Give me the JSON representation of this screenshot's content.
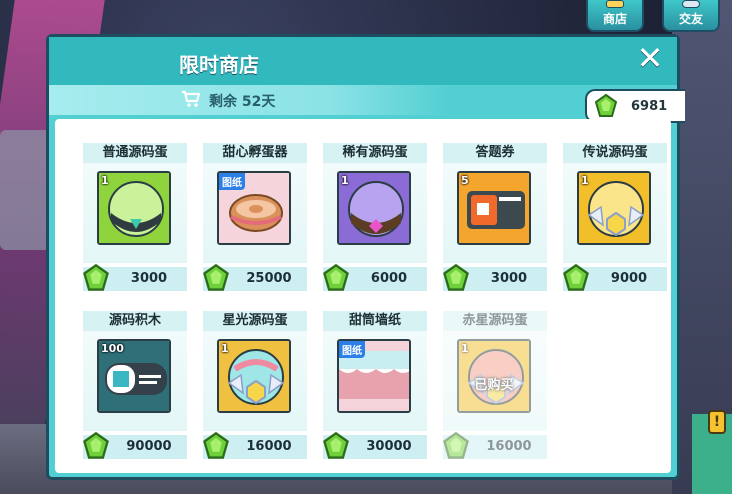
{
  "top_buttons": {
    "shop": "商店",
    "trade": "交友"
  },
  "side_alert": "!",
  "panel": {
    "title": "限时商店",
    "remaining": "剩余 52天",
    "currency": "6981",
    "close_icon": "close-icon",
    "cart_icon": "cart-icon",
    "currency_icon": "green-gem-icon"
  },
  "items": [
    {
      "name": "普通源码蛋",
      "qty": "1",
      "price": "3000",
      "kind": "egg-green",
      "badge": "",
      "sold": ""
    },
    {
      "name": "甜心孵蛋器",
      "qty": "",
      "price": "25000",
      "kind": "incubator",
      "badge": "图纸",
      "sold": ""
    },
    {
      "name": "稀有源码蛋",
      "qty": "1",
      "price": "6000",
      "kind": "egg-purple",
      "badge": "",
      "sold": ""
    },
    {
      "name": "答题券",
      "qty": "5",
      "price": "3000",
      "kind": "ticket",
      "badge": "",
      "sold": ""
    },
    {
      "name": "传说源码蛋",
      "qty": "1",
      "price": "9000",
      "kind": "egg-gold",
      "badge": "",
      "sold": ""
    },
    {
      "name": "源码积木",
      "qty": "100",
      "price": "90000",
      "kind": "block",
      "badge": "",
      "sold": ""
    },
    {
      "name": "星光源码蛋",
      "qty": "1",
      "price": "16000",
      "kind": "egg-rainbow",
      "badge": "",
      "sold": ""
    },
    {
      "name": "甜筒墙纸",
      "qty": "",
      "price": "30000",
      "kind": "wallpaper",
      "badge": "图纸",
      "sold": ""
    },
    {
      "name": "赤星源码蛋",
      "qty": "1",
      "price": "16000",
      "kind": "egg-red",
      "badge": "",
      "sold": "已购买"
    }
  ],
  "colors": {
    "panel": "#52cfd2",
    "header": "#31b9be",
    "border": "#1f4d60",
    "gem": "#6fd13a"
  }
}
